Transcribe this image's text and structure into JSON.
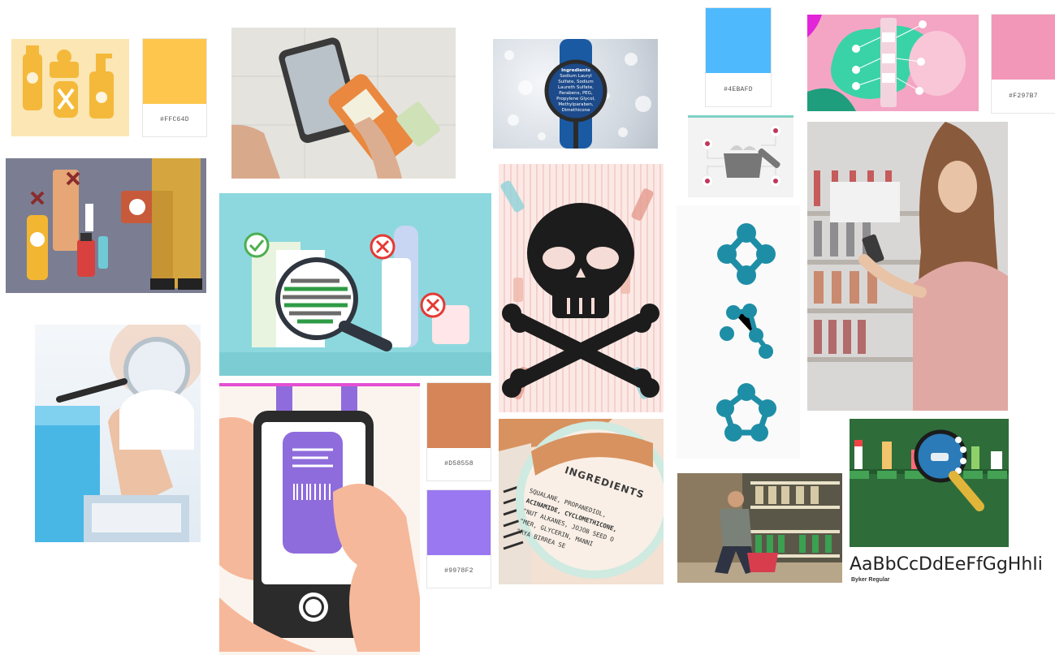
{
  "swatches": {
    "yellow": {
      "hex_label": "#FFC64D",
      "color": "#FFC64D"
    },
    "blue": {
      "hex_label": "#4EBAFD",
      "color": "#4EBAFD"
    },
    "pink": {
      "hex_label": "#F297B7",
      "color": "#F297B7"
    },
    "copper": {
      "hex_label": "#D58558",
      "color": "#D58558"
    },
    "purple": {
      "hex_label": "#9978F2",
      "color": "#9978F2"
    }
  },
  "bottle_label": {
    "title": "Ingredients",
    "lines": [
      "Sodium Lauryl",
      "Sulfate, Sodium",
      "Laureth Sulfate,",
      "Parabens, PEG,",
      "Propylene Glycol,",
      "Methylparaben,",
      "Dimethicone"
    ]
  },
  "ingredients_magnifier": {
    "title": "INGREDIENTS",
    "lines": [
      "SQUALANE, PROPANEDIOL,",
      "ACINAMIDE, CYCLOMETHICONE,",
      "\"NUT ALKANES, JOJOB SEED O",
      "\"MER, GLYCERIN, MANNI",
      "\"RYA BIRREA SE"
    ]
  },
  "typography": {
    "sample": "AaBbCcDdEeFfGgHhIi",
    "font_name": "Byker Regular"
  }
}
